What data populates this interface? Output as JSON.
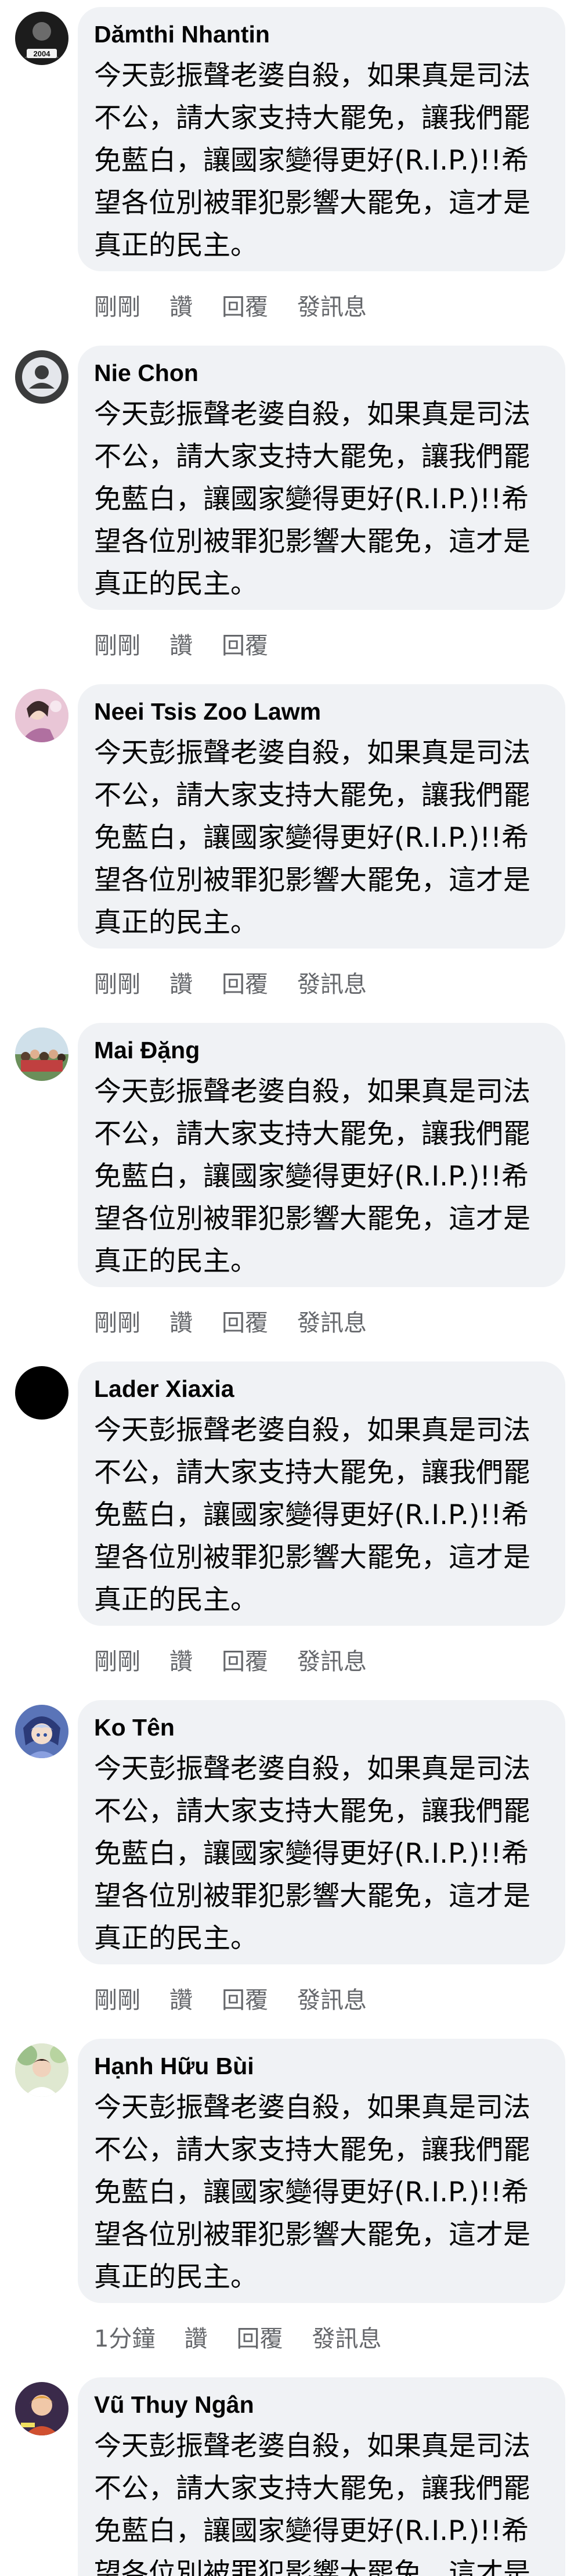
{
  "comments": [
    {
      "author": "Dămthi Nhantin",
      "text": "今天彭振聲老婆自殺，如果真是司法不公，請大家支持大罷免，讓我們罷免藍白，讓國家變得更好(R.I.P.)!!希望各位別被罪犯影響大罷免，這才是真正的民主。",
      "time": "剛剛",
      "like": "讚",
      "reply": "回覆",
      "message": "發訊息",
      "avatar_badge": "2004",
      "avatar_style": "dark-badge"
    },
    {
      "author": "Nie Chon",
      "text": "今天彭振聲老婆自殺，如果真是司法不公，請大家支持大罷免，讓我們罷免藍白，讓國家變得更好(R.I.P.)!!希望各位別被罪犯影響大罷免，這才是真正的民主。",
      "time": "剛剛",
      "like": "讚",
      "reply": "回覆",
      "avatar_style": "gray-person"
    },
    {
      "author": "Neei Tsis Zoo Lawm",
      "text": "今天彭振聲老婆自殺，如果真是司法不公，請大家支持大罷免，讓我們罷免藍白，讓國家變得更好(R.I.P.)!!希望各位別被罪犯影響大罷免，這才是真正的民主。",
      "time": "剛剛",
      "like": "讚",
      "reply": "回覆",
      "message": "發訊息",
      "avatar_style": "pink-portrait"
    },
    {
      "author": "Mai Đặng",
      "text": "今天彭振聲老婆自殺，如果真是司法不公，請大家支持大罷免，讓我們罷免藍白，讓國家變得更好(R.I.P.)!!希望各位別被罪犯影響大罷免，這才是真正的民主。",
      "time": "剛剛",
      "like": "讚",
      "reply": "回覆",
      "message": "發訊息",
      "avatar_style": "crowd-photo"
    },
    {
      "author": "Lader Xiaxia",
      "text": "今天彭振聲老婆自殺，如果真是司法不公，請大家支持大罷免，讓我們罷免藍白，讓國家變得更好(R.I.P.)!!希望各位別被罪犯影響大罷免，這才是真正的民主。",
      "time": "剛剛",
      "like": "讚",
      "reply": "回覆",
      "message": "發訊息",
      "avatar_style": "black"
    },
    {
      "author": "Ko Tên",
      "text": "今天彭振聲老婆自殺，如果真是司法不公，請大家支持大罷免，讓我們罷免藍白，讓國家變得更好(R.I.P.)!!希望各位別被罪犯影響大罷免，這才是真正的民主。",
      "time": "剛剛",
      "like": "讚",
      "reply": "回覆",
      "message": "發訊息",
      "avatar_style": "anime-blue"
    },
    {
      "author": "Hạnh Hữu Bùi",
      "text": "今天彭振聲老婆自殺，如果真是司法不公，請大家支持大罷免，讓我們罷免藍白，讓國家變得更好(R.I.P.)!!希望各位別被罪犯影響大罷免，這才是真正的民主。",
      "time": "1分鐘",
      "like": "讚",
      "reply": "回覆",
      "message": "發訊息",
      "avatar_style": "green-portrait"
    },
    {
      "author": "Vũ Thuy Ngân",
      "text": "今天彭振聲老婆自殺，如果真是司法不公，請大家支持大罷免，讓我們罷免藍白，讓國家變得更好(R.I.P.)!!希望各位別被罪犯影響大罷免，這才是真正的民主。",
      "avatar_style": "orange-portrait"
    }
  ],
  "colors": {
    "bubble": "#f0f2f5",
    "author_text": "#050505",
    "meta_text": "#65676b",
    "background": "#ffffff"
  }
}
